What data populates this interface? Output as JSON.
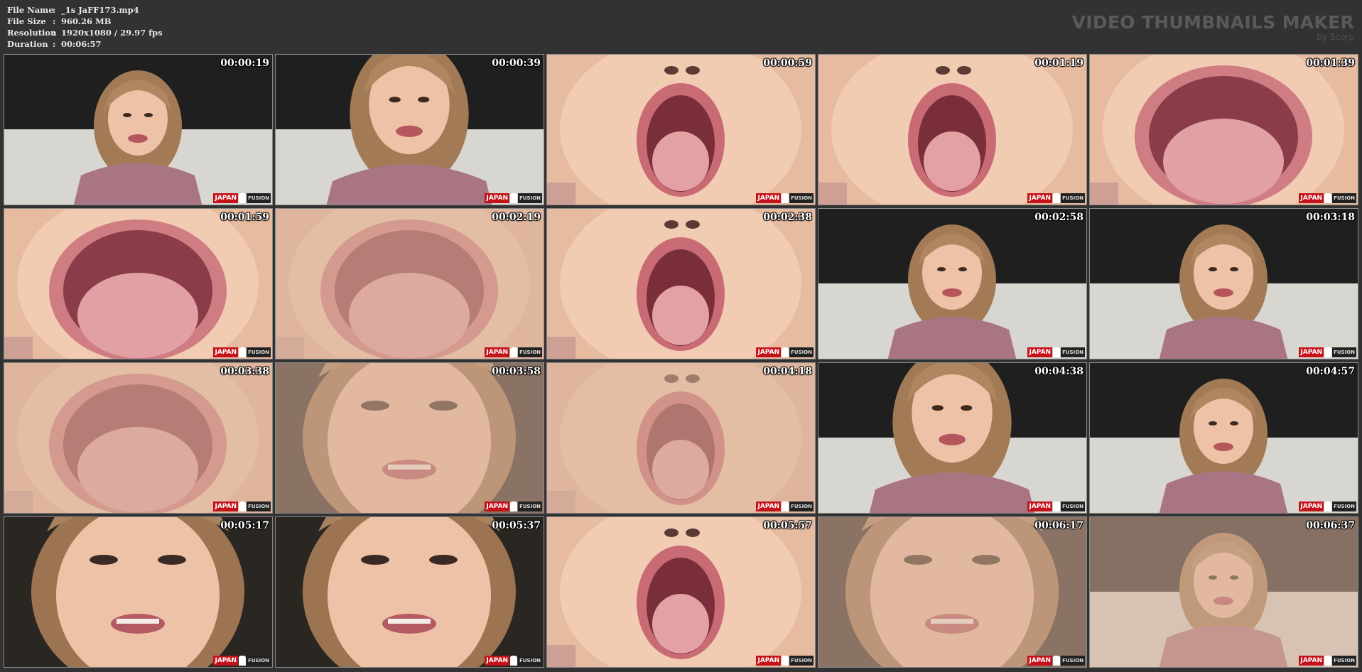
{
  "file_info": [
    {
      "key": "File Name",
      "value": "_1s JaFF173.mp4"
    },
    {
      "key": "File Size",
      "value": "960.26 MB"
    },
    {
      "key": "Resolution",
      "value": "1920x1080 / 29.97 fps"
    },
    {
      "key": "Duration",
      "value": "00:06:57"
    }
  ],
  "brand": {
    "title": "VIDEO THUMBNAILS MAKER",
    "byline": "by Scorp"
  },
  "watermark": {
    "left": "JAPAN",
    "right": "FUSION"
  },
  "thumbnails": [
    {
      "time": "00:00:19",
      "shot": "wide"
    },
    {
      "time": "00:00:39",
      "shot": "medium"
    },
    {
      "time": "00:00:59",
      "shot": "mouth-open"
    },
    {
      "time": "00:01:19",
      "shot": "mouth-open"
    },
    {
      "time": "00:01:39",
      "shot": "mouth-closeup"
    },
    {
      "time": "00:01:59",
      "shot": "mouth-closeup"
    },
    {
      "time": "00:02:19",
      "shot": "mouth-closeup-blur"
    },
    {
      "time": "00:02:38",
      "shot": "mouth-open"
    },
    {
      "time": "00:02:58",
      "shot": "wide"
    },
    {
      "time": "00:03:18",
      "shot": "wide"
    },
    {
      "time": "00:03:38",
      "shot": "mouth-closeup-blur"
    },
    {
      "time": "00:03:58",
      "shot": "face-closeup-blur"
    },
    {
      "time": "00:04:18",
      "shot": "mouth-open-blur"
    },
    {
      "time": "00:04:38",
      "shot": "medium"
    },
    {
      "time": "00:04:57",
      "shot": "wide"
    },
    {
      "time": "00:05:17",
      "shot": "face-closeup"
    },
    {
      "time": "00:05:37",
      "shot": "face-closeup"
    },
    {
      "time": "00:05:57",
      "shot": "mouth-open"
    },
    {
      "time": "00:06:17",
      "shot": "face-closeup-blur"
    },
    {
      "time": "00:06:37",
      "shot": "wide-blur"
    }
  ]
}
